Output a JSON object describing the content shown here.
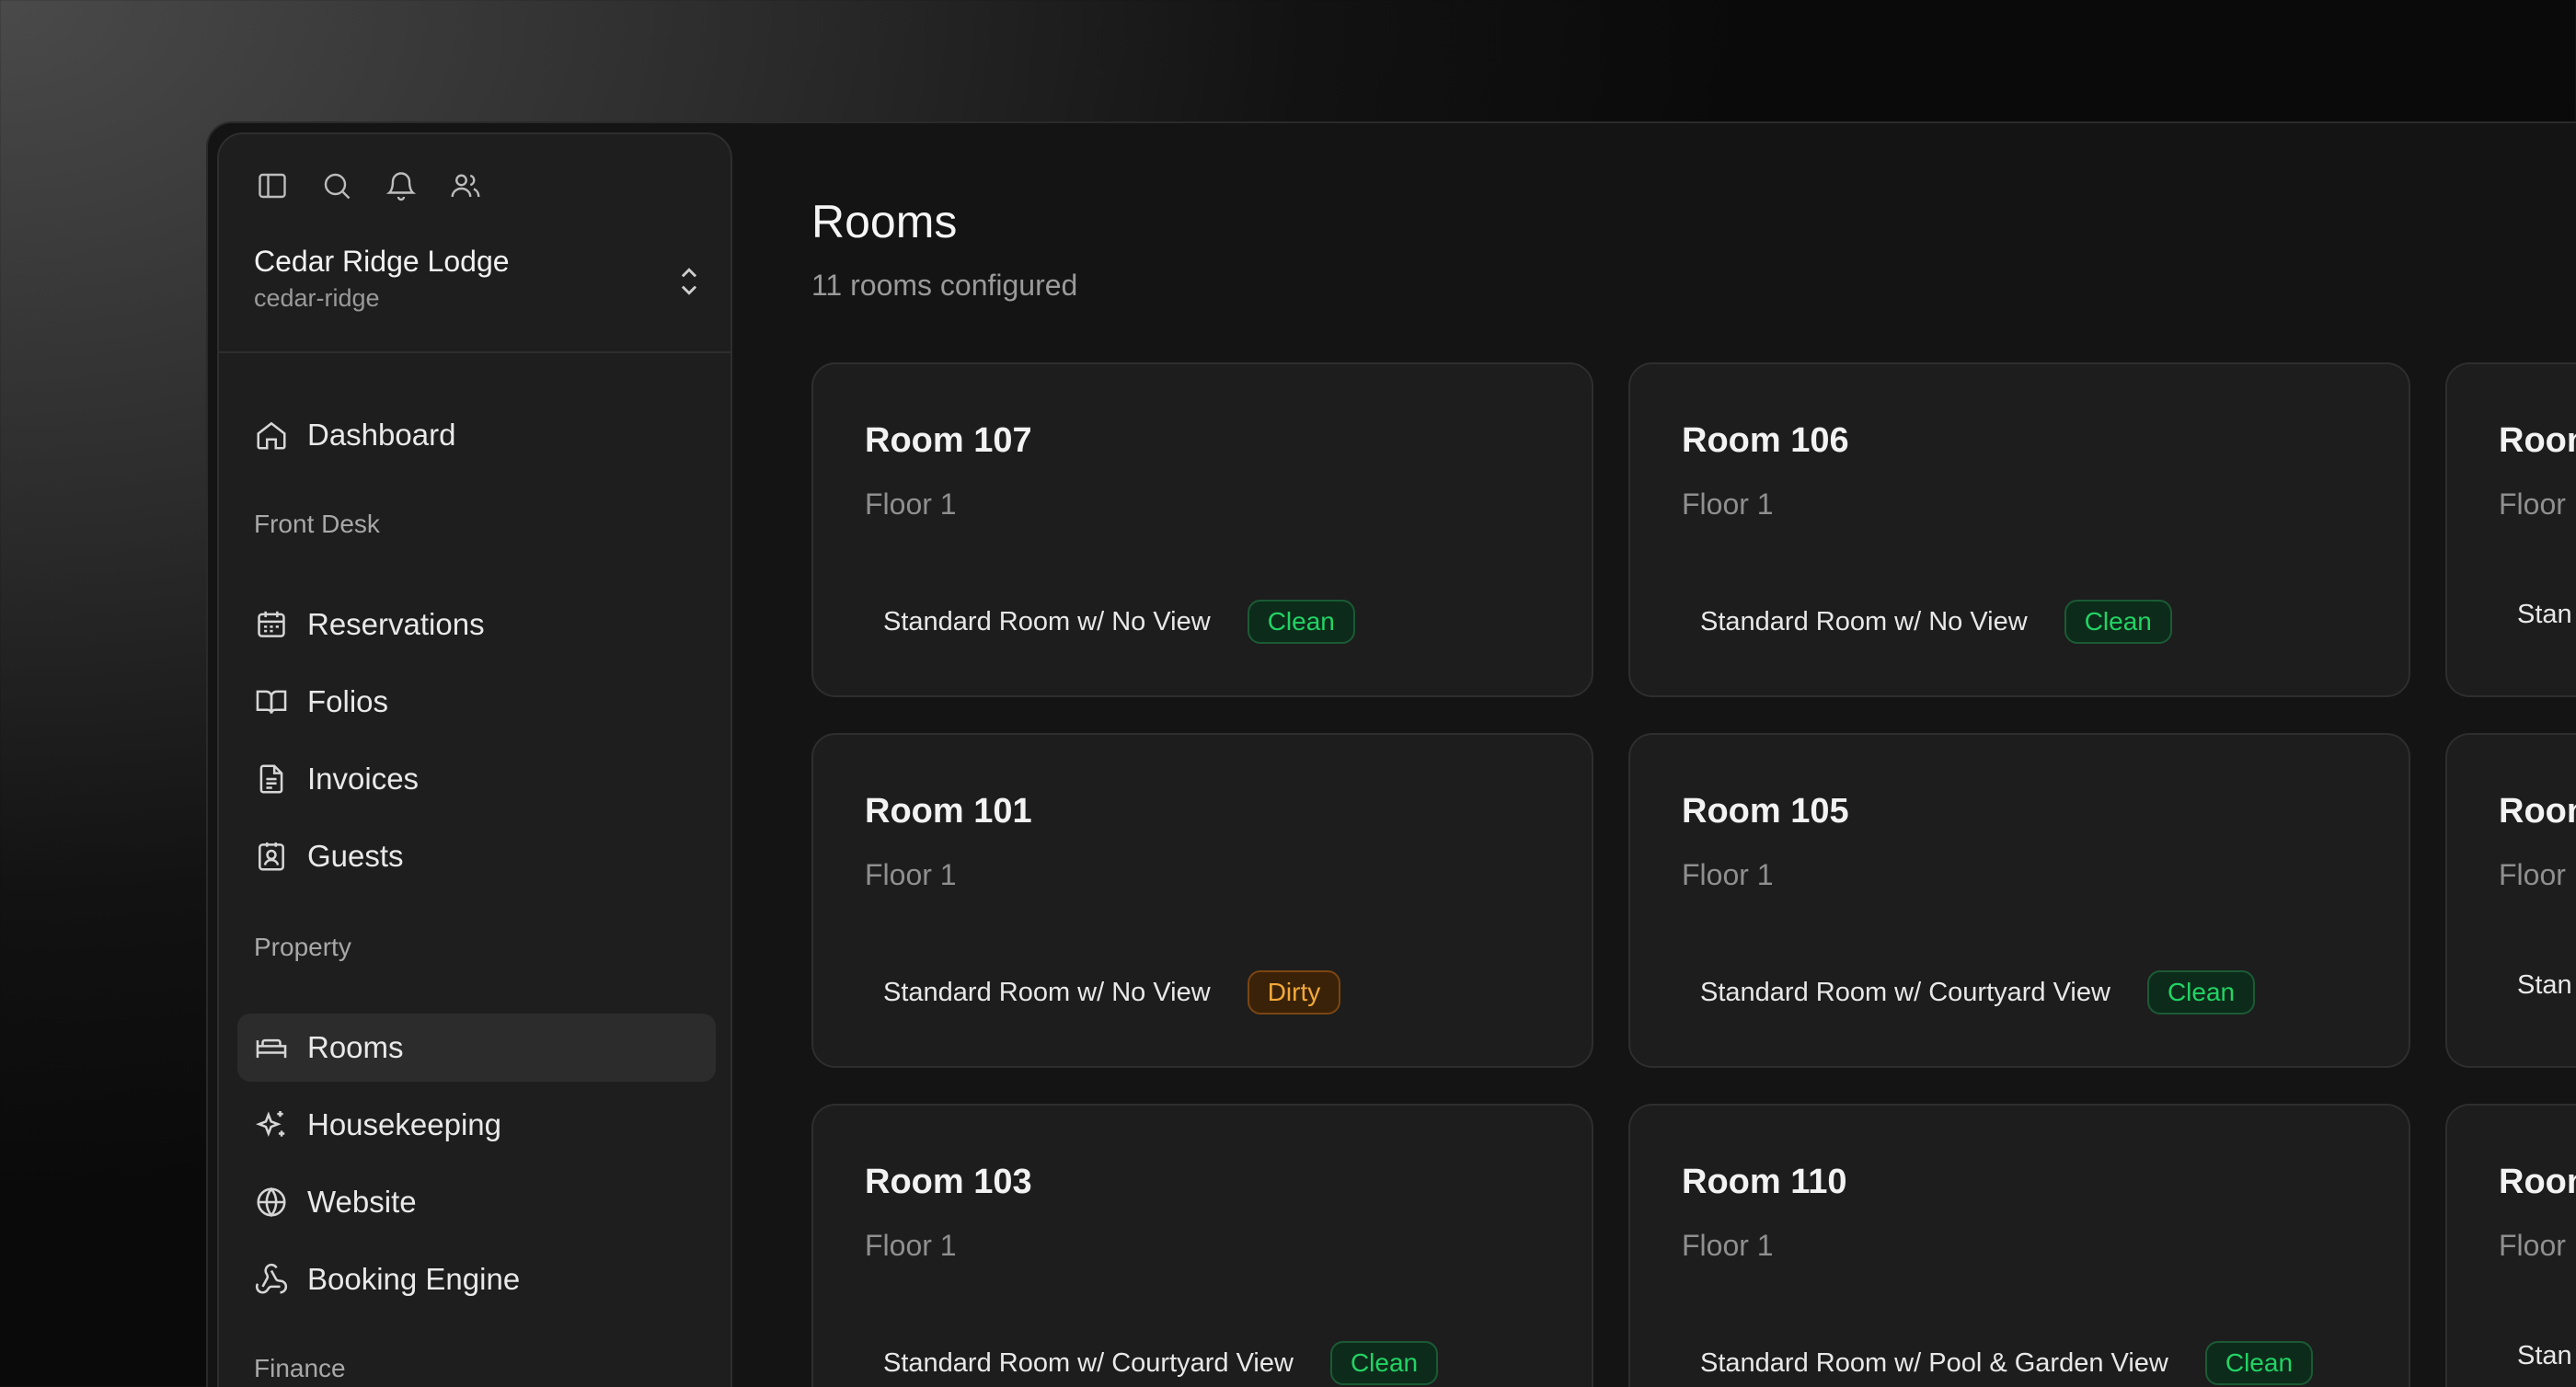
{
  "sidebar": {
    "top_icons": [
      "sidebar-toggle-icon",
      "search-icon",
      "bell-icon",
      "users-icon"
    ],
    "property": {
      "name": "Cedar Ridge Lodge",
      "slug": "cedar-ridge"
    },
    "dashboard": "Dashboard",
    "sections": {
      "front_desk": {
        "label": "Front Desk",
        "items": [
          "Reservations",
          "Folios",
          "Invoices",
          "Guests"
        ]
      },
      "property": {
        "label": "Property",
        "items": [
          "Rooms",
          "Housekeeping",
          "Website",
          "Booking Engine"
        ]
      },
      "finance": {
        "label": "Finance"
      }
    },
    "active_item": "Rooms"
  },
  "main": {
    "title": "Rooms",
    "subtitle": "11 rooms configured",
    "rooms": [
      {
        "name": "Room 107",
        "floor": "Floor 1",
        "type": "Standard Room w/ No View",
        "status": "Clean"
      },
      {
        "name": "Room 106",
        "floor": "Floor 1",
        "type": "Standard Room w/ No View",
        "status": "Clean"
      },
      {
        "name": "Roon",
        "floor": "Floor",
        "type": "Stan",
        "status": ""
      },
      {
        "name": "Room 101",
        "floor": "Floor 1",
        "type": "Standard Room w/ No View",
        "status": "Dirty"
      },
      {
        "name": "Room 105",
        "floor": "Floor 1",
        "type": "Standard Room w/ Courtyard View",
        "status": "Clean"
      },
      {
        "name": "Roon",
        "floor": "Floor",
        "type": "Stan",
        "status": ""
      },
      {
        "name": "Room 103",
        "floor": "Floor 1",
        "type": "Standard Room w/ Courtyard View",
        "status": "Clean"
      },
      {
        "name": "Room 110",
        "floor": "Floor 1",
        "type": "Standard Room w/ Pool & Garden View",
        "status": "Clean"
      },
      {
        "name": "Roon",
        "floor": "Floor",
        "type": "Stan",
        "status": ""
      }
    ]
  },
  "colors": {
    "clean": "#22d365",
    "dirty": "#f3a93a",
    "background": "#141414",
    "card": "#1d1d1d"
  }
}
